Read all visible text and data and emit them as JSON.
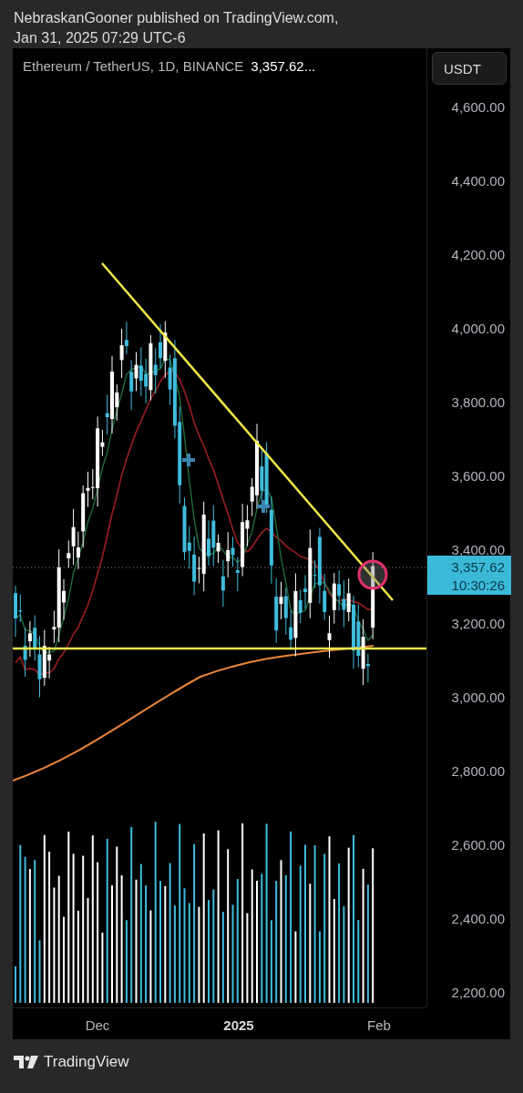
{
  "header": {
    "lines": [
      "NebraskanGooner published on TradingView.com,",
      "Jan 31, 2025 07:29 UTC-6"
    ]
  },
  "chart": {
    "symbol": "Ethereum / TetherUS, 1D, BINANCE",
    "last_price": "3,357.62...",
    "currency_button": "USDT",
    "price_ticks": [
      "4,600.00",
      "4,400.00",
      "4,200.00",
      "4,000.00",
      "3,800.00",
      "3,600.00",
      "3,400.00",
      "3,200.00",
      "3,000.00",
      "2,800.00",
      "2,600.00",
      "2,400.00",
      "2,200.00"
    ],
    "current_price": {
      "value": "3,357.62",
      "countdown": "10:30:26"
    },
    "time_labels": [
      {
        "label": "Dec",
        "kind": "month"
      },
      {
        "label": "2025",
        "kind": "year"
      },
      {
        "label": "Feb",
        "kind": "month"
      }
    ]
  },
  "footer": {
    "brand": "TradingView"
  }
}
